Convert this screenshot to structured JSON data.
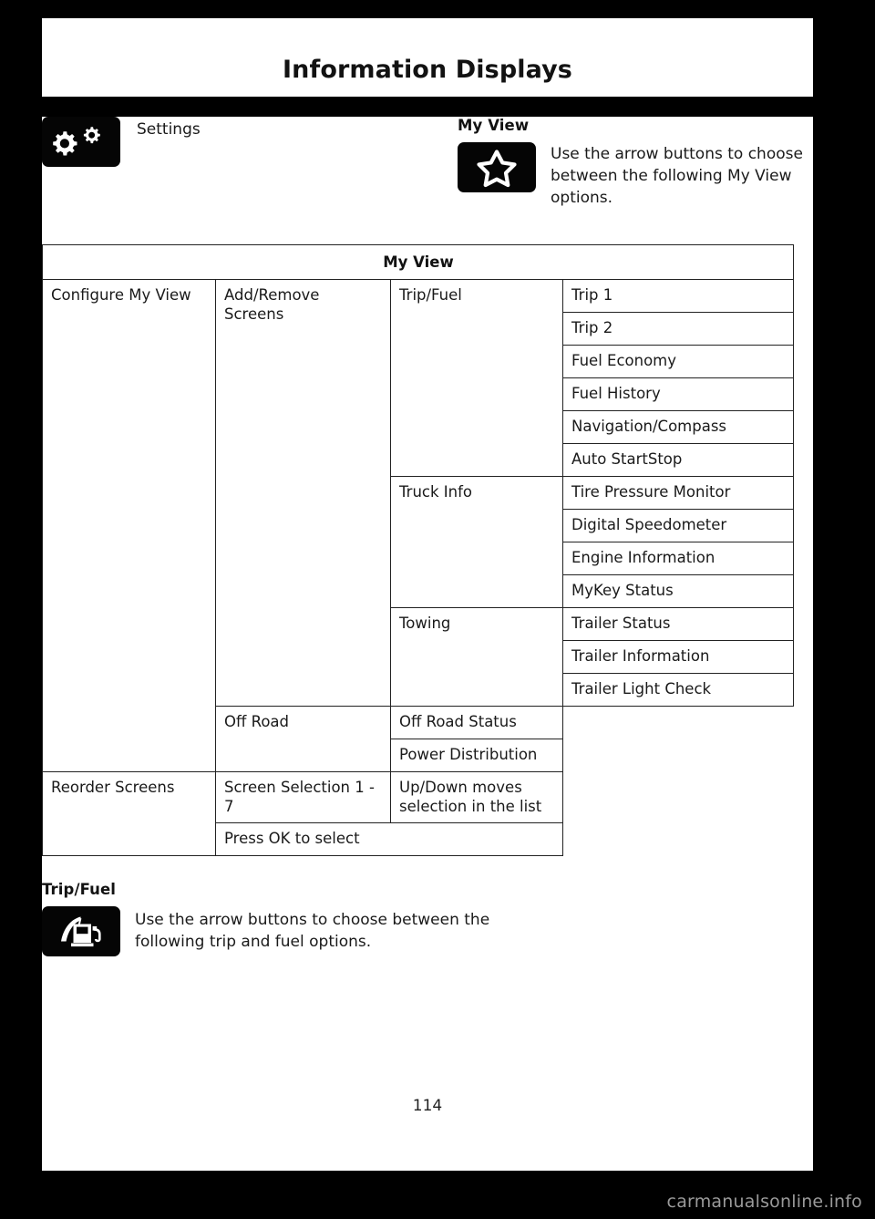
{
  "header": {
    "title": "Information Displays"
  },
  "intro": {
    "settings": {
      "icon": "gears-icon",
      "label": "Settings"
    },
    "my_view": {
      "heading": "My View",
      "icon": "star-icon",
      "description": "Use the arrow buttons to choose between the following My View options."
    }
  },
  "table": {
    "title": "My View",
    "rows": {
      "configure_my_view": "Configure My View",
      "add_remove_screens": "Add/Remove Screens",
      "reorder_screens": "Reorder Screens",
      "groups": {
        "trip_fuel": "Trip/Fuel",
        "truck_info": "Truck Info",
        "towing": "Towing",
        "off_road": "Off Road",
        "screen_selection": "Screen Selection 1 - 7"
      },
      "items": {
        "trip_1": "Trip 1",
        "trip_2": "Trip 2",
        "fuel_economy": "Fuel Economy",
        "fuel_history": "Fuel History",
        "navigation_compass": "Navigation/Compass",
        "auto_startstop": "Auto StartStop",
        "tire_pressure_monitor": "Tire Pressure Monitor",
        "digital_speedometer": "Digital Speedometer",
        "engine_information": "Engine Information",
        "mykey_status": "MyKey Status",
        "trailer_status": "Trailer Status",
        "trailer_information": "Trailer Information",
        "trailer_light_check": "Trailer Light Check",
        "off_road_status": "Off Road Status",
        "power_distribution": "Power Distribution",
        "up_down_moves": "Up/Down moves selection in the list",
        "press_ok": "Press OK to select"
      }
    }
  },
  "lower": {
    "heading": "Trip/Fuel",
    "icon": "fuel-pump-icon",
    "description": "Use the arrow buttons to choose between the following trip and fuel options."
  },
  "footer": {
    "page_number": "114",
    "watermark": "carmanualsonline.info"
  }
}
